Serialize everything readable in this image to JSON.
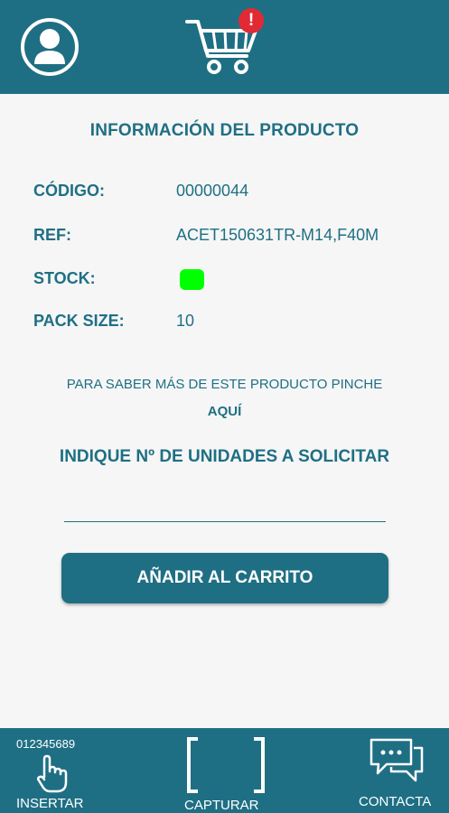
{
  "header": {
    "avatar_icon": "user-avatar-icon",
    "cart_icon": "shopping-cart-icon",
    "cart_badge": "!",
    "badge_color": "#e12a34"
  },
  "product": {
    "section_title": "INFORMACIÓN DEL PRODUCTO",
    "code_label": "CÓDIGO:",
    "code_value": "00000044",
    "ref_label": "REF:",
    "ref_value": "ACET150631TR-M14,F40M",
    "stock_label": "STOCK:",
    "stock_color": "#00ff00",
    "pack_label": "PACK SIZE:",
    "pack_value": "10"
  },
  "more_info": {
    "text": "PARA SABER MÁS DE ESTE PRODUCTO PINCHE",
    "link": "AQUÍ"
  },
  "order": {
    "units_title": "INDIQUE Nº DE UNIDADES A SOLICITAR",
    "quantity_value": "",
    "add_button": "AÑADIR AL CARRITO"
  },
  "bottom_nav": {
    "insert_numbers": "012345689",
    "insert_label": "INSERTAR",
    "capture_label": "CAPTURAR",
    "contact_label": "CONTACTA"
  },
  "colors": {
    "primary": "#1f6f84",
    "background": "#f6f6f6"
  }
}
